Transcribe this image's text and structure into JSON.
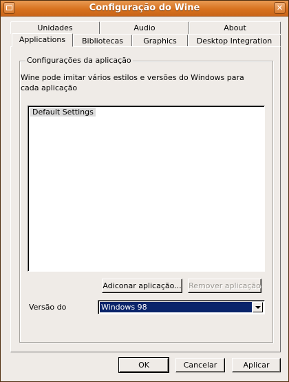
{
  "window": {
    "title": "Configuração do Wine"
  },
  "tabs_top": [
    "Unidades",
    "Audio",
    "About"
  ],
  "tabs_bottom": [
    "Applications",
    "Bibliotecas",
    "Graphics",
    "Desktop Integration"
  ],
  "active_tab": "Applications",
  "group": {
    "title": "Configurações da aplicação",
    "description": "Wine pode imitar vários estilos e versões do Windows para cada aplicação"
  },
  "app_list": {
    "items": [
      "Default Settings"
    ],
    "selected": "Default Settings"
  },
  "buttons": {
    "add": "Adiconar aplicação...",
    "remove": "Remover aplicação",
    "ok": "OK",
    "cancel": "Cancelar",
    "apply": "Aplicar"
  },
  "version": {
    "label": "Versão do",
    "value": "Windows 98"
  },
  "icons": {
    "window_menu": "window-menu-icon",
    "close": "close-icon",
    "dropdown": "chevron-down-icon"
  },
  "colors": {
    "titlebar": "#d8721f",
    "selection": "#0a246a",
    "window_bg": "#efebe7"
  }
}
